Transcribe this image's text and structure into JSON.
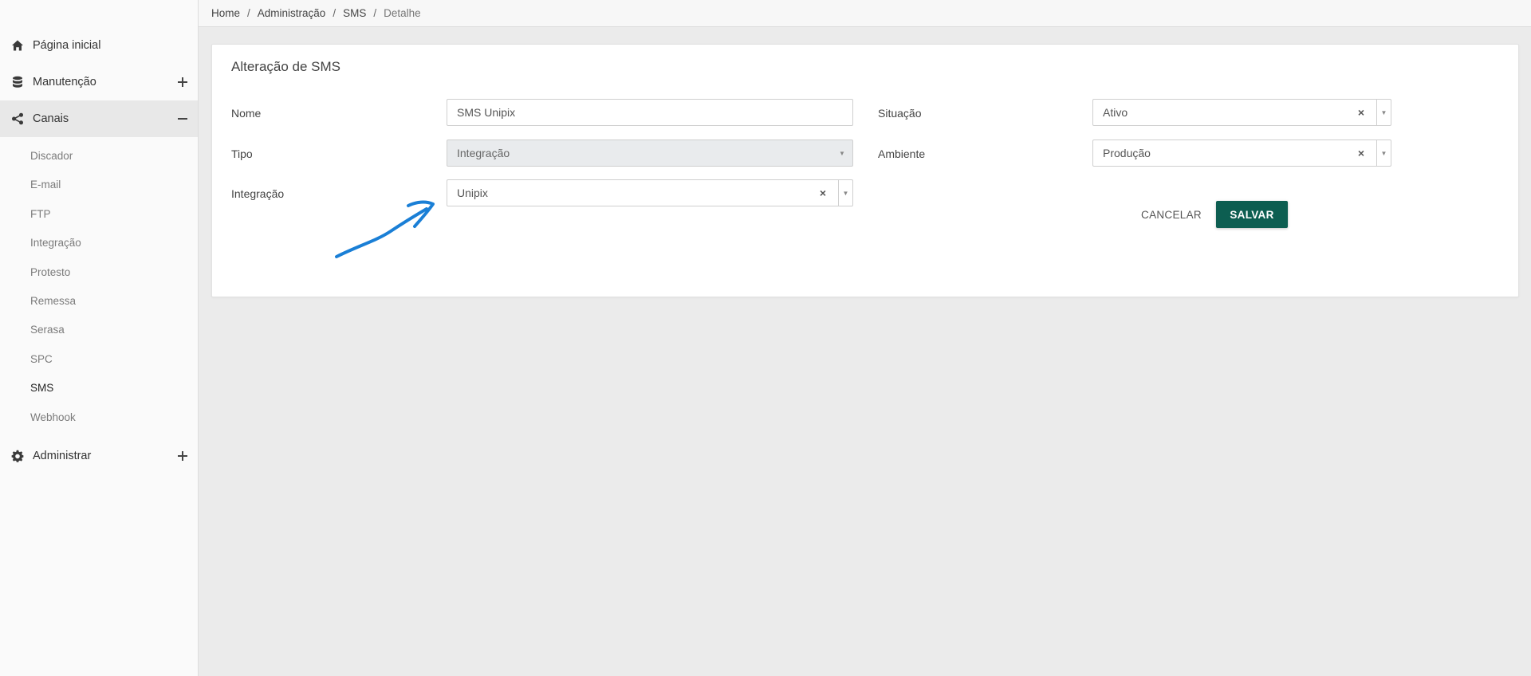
{
  "breadcrumb": {
    "items": [
      "Home",
      "Administração",
      "SMS"
    ],
    "current": "Detalhe",
    "separator": "/"
  },
  "sidebar": {
    "main": [
      {
        "label": "Página inicial",
        "icon": "home-icon"
      },
      {
        "label": "Manutenção",
        "icon": "database-icon",
        "toggle": "plus"
      },
      {
        "label": "Canais",
        "icon": "share-icon",
        "toggle": "minus"
      },
      {
        "label": "Administrar",
        "icon": "gear-icon",
        "toggle": "plus"
      }
    ],
    "sub": [
      "Discador",
      "E-mail",
      "FTP",
      "Integração",
      "Protesto",
      "Remessa",
      "Serasa",
      "SPC",
      "SMS",
      "Webhook"
    ],
    "active_sub": "SMS"
  },
  "form": {
    "title": "Alteração de SMS",
    "nome": {
      "label": "Nome",
      "value": "SMS Unipix"
    },
    "tipo": {
      "label": "Tipo",
      "value": "Integração"
    },
    "integracao": {
      "label": "Integração",
      "value": "Unipix"
    },
    "situacao": {
      "label": "Situação",
      "value": "Ativo"
    },
    "ambiente": {
      "label": "Ambiente",
      "value": "Produção"
    },
    "cancel_label": "CANCELAR",
    "save_label": "SALVAR",
    "clear_glyph": "×",
    "arrow_glyph": "▼"
  },
  "colors": {
    "primary": "#0d5e51",
    "annotation": "#1a7fd6"
  }
}
